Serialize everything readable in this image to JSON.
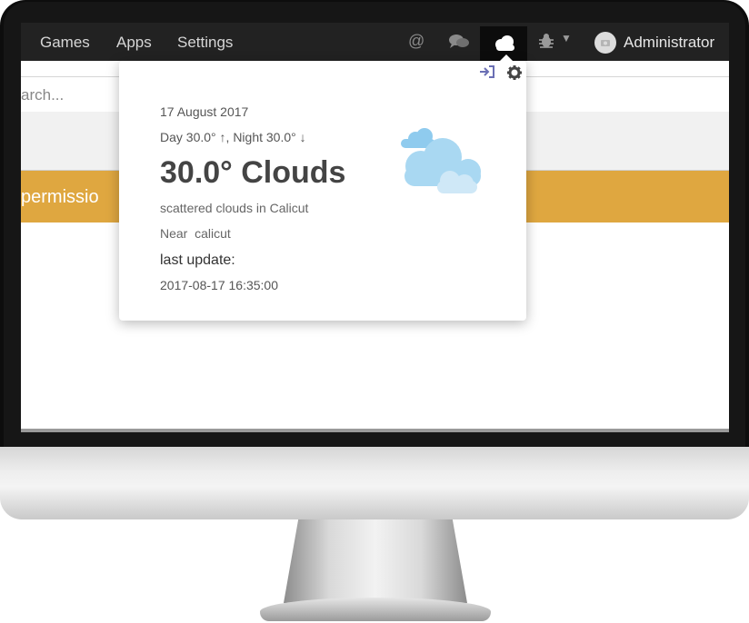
{
  "navbar": {
    "items": [
      "Games",
      "Apps",
      "Settings"
    ],
    "icons": [
      "at-icon",
      "chat-icon",
      "cloud-icon",
      "bug-icon"
    ],
    "user": "Administrator"
  },
  "search": {
    "placeholder": "arch..."
  },
  "alert": {
    "text": "permissio"
  },
  "weather": {
    "date": "17 August 2017",
    "day_label": "Day 30.0°",
    "night_label": "Night 30.0°",
    "temp": "30.0°",
    "condition": "Clouds",
    "description": "scattered clouds in Calicut",
    "near_label": "Near",
    "near_value": "calicut",
    "last_update_label": "last update:",
    "last_update_value": "2017-08-17 16:35:00"
  },
  "colors": {
    "navbar": "#222222",
    "alert": "#dfa740",
    "cloud_light": "#cfe8f7",
    "cloud_mid": "#a9d8f2"
  }
}
